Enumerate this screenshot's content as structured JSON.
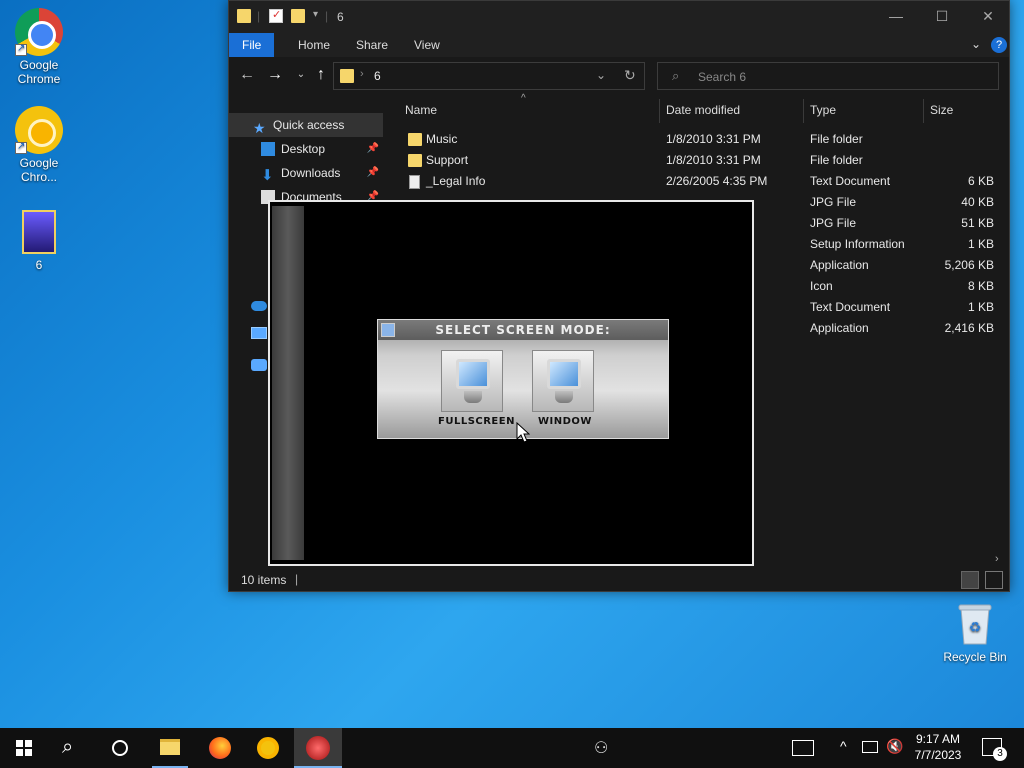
{
  "desktop": {
    "icons": [
      {
        "label": "Google Chrome",
        "icon": "chrome-icon"
      },
      {
        "label": "Google Chro...",
        "icon": "chrome-canary-icon"
      },
      {
        "label": "6",
        "icon": "game-file-icon"
      },
      {
        "label": "Recycle Bin",
        "icon": "recycle-bin-icon"
      }
    ]
  },
  "explorer": {
    "title": "6",
    "ribbon_tabs": [
      "File",
      "Home",
      "Share",
      "View"
    ],
    "address": "6",
    "search_placeholder": "Search 6",
    "nav": [
      {
        "label": "Quick access",
        "icon": "star-icon"
      },
      {
        "label": "Desktop",
        "icon": "desktop-icon"
      },
      {
        "label": "Downloads",
        "icon": "download-icon"
      },
      {
        "label": "Documents",
        "icon": "documents-icon"
      }
    ],
    "columns": [
      "Name",
      "Date modified",
      "Type",
      "Size"
    ],
    "rows": [
      {
        "name": "Music",
        "date": "1/8/2010 3:31 PM",
        "type": "File folder",
        "size": ""
      },
      {
        "name": "Support",
        "date": "1/8/2010 3:31 PM",
        "type": "File folder",
        "size": ""
      },
      {
        "name": "_Legal Info",
        "date": "2/26/2005 4:35 PM",
        "type": "Text Document",
        "size": "6 KB"
      },
      {
        "name": "",
        "date": "",
        "type": "JPG File",
        "size": "40 KB"
      },
      {
        "name": "",
        "date": "",
        "type": "JPG File",
        "size": "51 KB"
      },
      {
        "name": "",
        "date": "",
        "type": "Setup Information",
        "size": "1 KB"
      },
      {
        "name": "",
        "date": "",
        "type": "Application",
        "size": "5,206 KB"
      },
      {
        "name": "",
        "date": "",
        "type": "Icon",
        "size": "8 KB"
      },
      {
        "name": "",
        "date": "",
        "type": "Text Document",
        "size": "1 KB"
      },
      {
        "name": "",
        "date": "",
        "type": "Application",
        "size": "2,416 KB"
      }
    ],
    "status": "10 items"
  },
  "game": {
    "dialog_title": "SELECT SCREEN MODE:",
    "fullscreen_label": "FULLSCREEN",
    "window_label": "WINDOW"
  },
  "taskbar": {
    "time": "9:17 AM",
    "date": "7/7/2023",
    "notifications": "3"
  }
}
